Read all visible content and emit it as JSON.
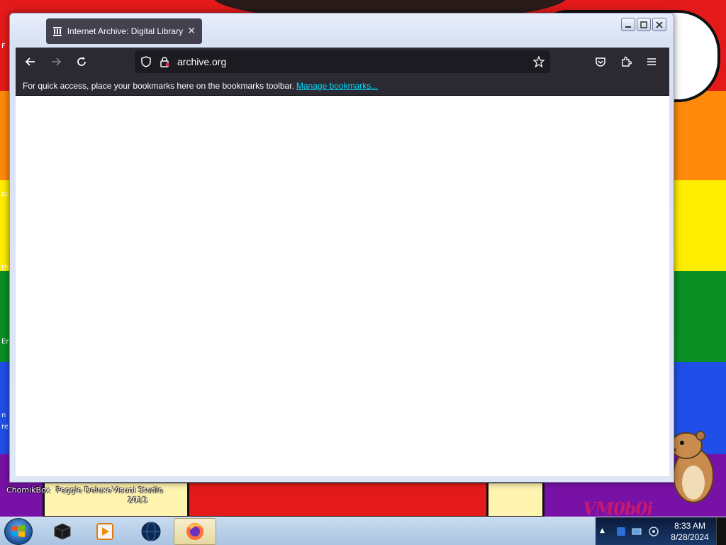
{
  "desktop": {
    "edge_labels": [
      "F",
      "sc",
      "th",
      "Er",
      "n",
      "re"
    ],
    "icons": [
      {
        "label": "ChomikBox"
      },
      {
        "label": "Peggle Deluxe"
      },
      {
        "label": "Visual Studio 2015"
      }
    ],
    "wallpaper_text": "VM0b0i"
  },
  "browser": {
    "tab": {
      "title": "Internet Archive: Digital Library",
      "icon": "archive-building-icon"
    },
    "url": "archive.org",
    "bookmarks_bar": {
      "message": "For quick access, place your bookmarks here on the bookmarks toolbar.",
      "link": "Manage bookmarks..."
    },
    "window_controls": [
      "minimize",
      "restore",
      "close"
    ],
    "toolbar_icons": [
      "pocket-icon",
      "extensions-icon",
      "menu-icon"
    ]
  },
  "taskbar": {
    "items": [
      {
        "name": "cube-app-icon",
        "active": false
      },
      {
        "name": "media-player-icon",
        "active": false
      },
      {
        "name": "globe-app-icon",
        "active": false
      },
      {
        "name": "firefox-icon",
        "active": true
      }
    ],
    "clock": {
      "time": "8:33 AM",
      "date": "8/28/2024"
    }
  },
  "colors": {
    "toolbar": "#2b2a33",
    "urlbar": "#1c1b22",
    "tab": "#42414d",
    "link": "#00ddff"
  }
}
